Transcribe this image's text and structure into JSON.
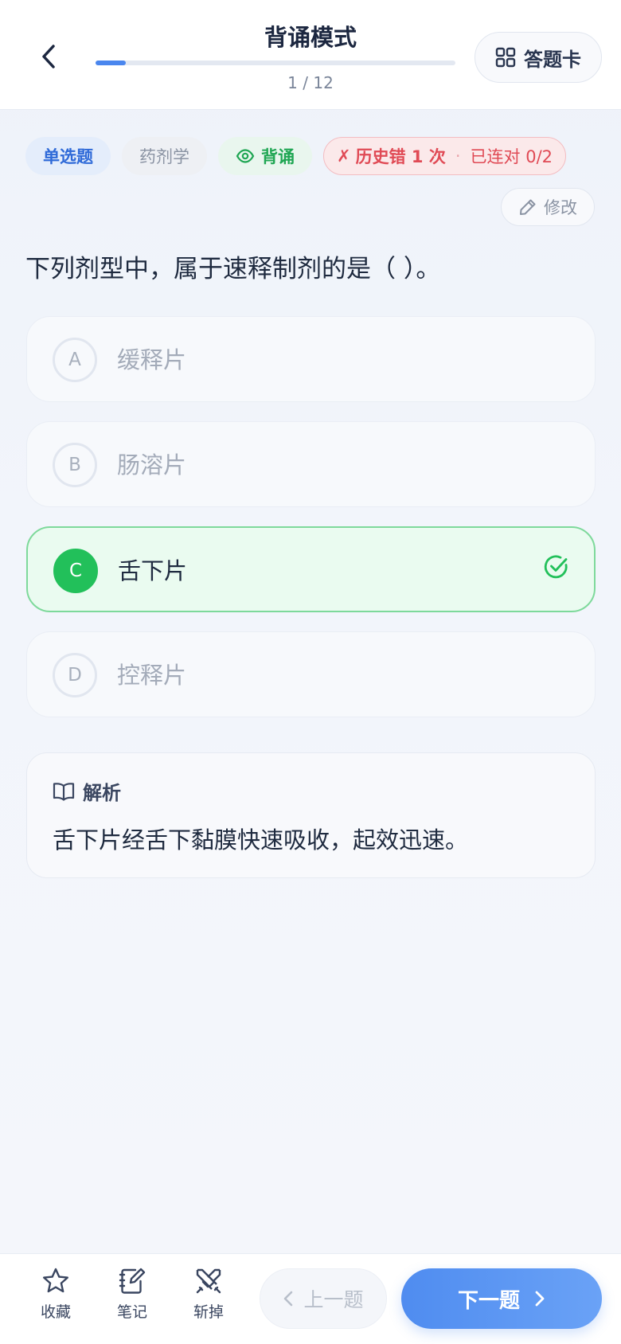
{
  "header": {
    "title": "背诵模式",
    "progress_text": "1 / 12",
    "progress_fraction": 0.0833,
    "answer_card_label": "答题卡"
  },
  "tags": {
    "type": "单选题",
    "subject": "药剂学",
    "mode": "背诵",
    "history_wrong": "历史错 1 次",
    "history_streak": "已连对 0/2"
  },
  "edit_label": "修改",
  "question": "下列剂型中，属于速释制剂的是（ ）。",
  "options": [
    {
      "letter": "A",
      "text": "缓释片"
    },
    {
      "letter": "B",
      "text": "肠溶片"
    },
    {
      "letter": "C",
      "text": "舌下片",
      "correct": true
    },
    {
      "letter": "D",
      "text": "控释片"
    }
  ],
  "analysis": {
    "title": "解析",
    "text": "舌下片经舌下黏膜快速吸收，起效迅速。"
  },
  "bottom_bar": {
    "favorite": "收藏",
    "notes": "笔记",
    "remove": "斩掉",
    "prev": "上一题",
    "next": "下一题"
  },
  "colors": {
    "accent": "#4a86ee",
    "correct": "#22c05a",
    "error": "#e04a55"
  }
}
